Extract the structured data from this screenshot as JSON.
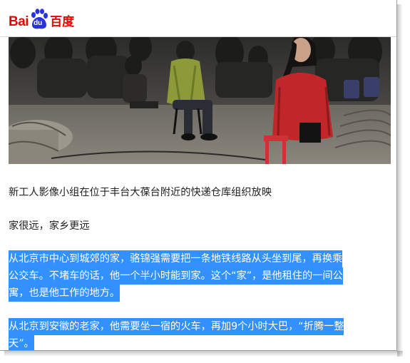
{
  "logo": {
    "left_text": "Bai",
    "paw_text": "du",
    "right_text": "百度",
    "brand_color": "#e10601",
    "paw_color": "#2932e1"
  },
  "article": {
    "photo_icon": "audience-screening-photo",
    "caption": "新工人影像小组在位于丰台大葆台附近的快递仓库组织放映",
    "subheading": "家很远，家乡更远",
    "paragraph1_lines": [
      "从北京市中心到城郊的家，骆锦强需要把一条地铁线路从头坐到尾，再换乘",
      "公交车。不堵车的话，他一个半小时能到家。这个“家”，是他租住的一间公",
      "寓，也是他工作的地方。"
    ],
    "paragraph2_lines": [
      "从北京到安徽的老家，他需要坐一宿的火车，再加9个小时大巴，“折腾一整",
      "天”。"
    ],
    "selection_color": "#3390ff"
  }
}
